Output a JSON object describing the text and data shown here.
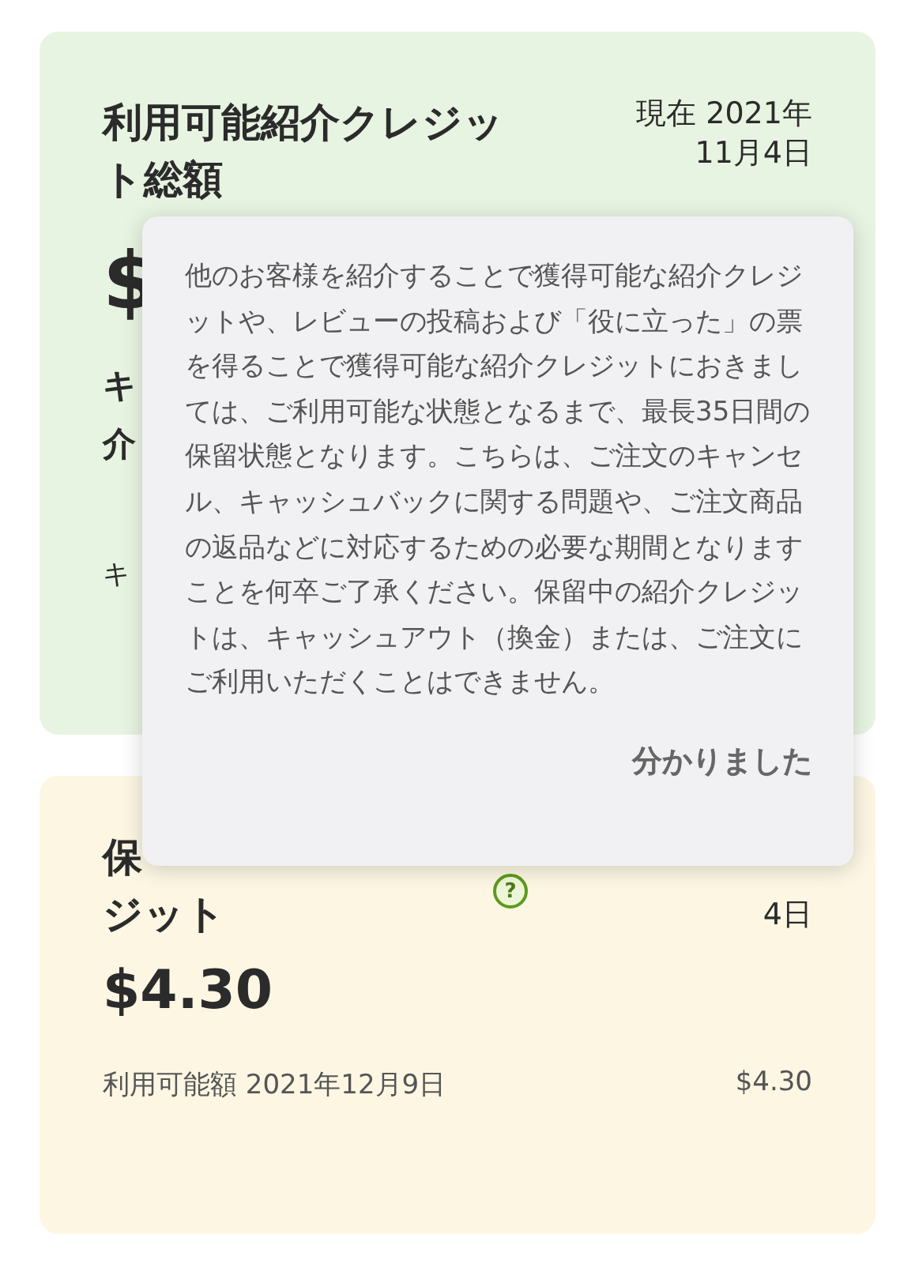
{
  "available_card": {
    "title": "利用可能紹介クレジット総額",
    "date": "現在 2021年11月4日",
    "amount": "$",
    "rows": [
      {
        "kind": "bold",
        "text": "キ"
      },
      {
        "kind": "bold",
        "text": "介"
      },
      {
        "kind": "small",
        "text": "キ"
      }
    ]
  },
  "pending_card": {
    "title_lines": [
      "保",
      "ジット"
    ],
    "help_icon": "?",
    "date_lines": [
      "4日"
    ],
    "amount": "$4.30",
    "detail": {
      "label": "利用可能額 2021年12月9日",
      "value": "$4.30"
    }
  },
  "popup": {
    "message": "他のお客様を紹介することで獲得可能な紹介クレジットや、レビューの投稿および「役に立った」の票を得ることで獲得可能な紹介クレジットにおきましては、ご利用可能な状態となるまで、最長35日間の保留状態となります。こちらは、ご注文のキャンセル、キャッシュバックに関する問題や、ご注文商品の返品などに対応するための必要な期間となりますことを何卒ご了承ください。保留中の紹介クレジットは、キャッシュアウト（換金）または、ご注文にご利用いただくことはできません。",
    "button": "分かりました"
  }
}
